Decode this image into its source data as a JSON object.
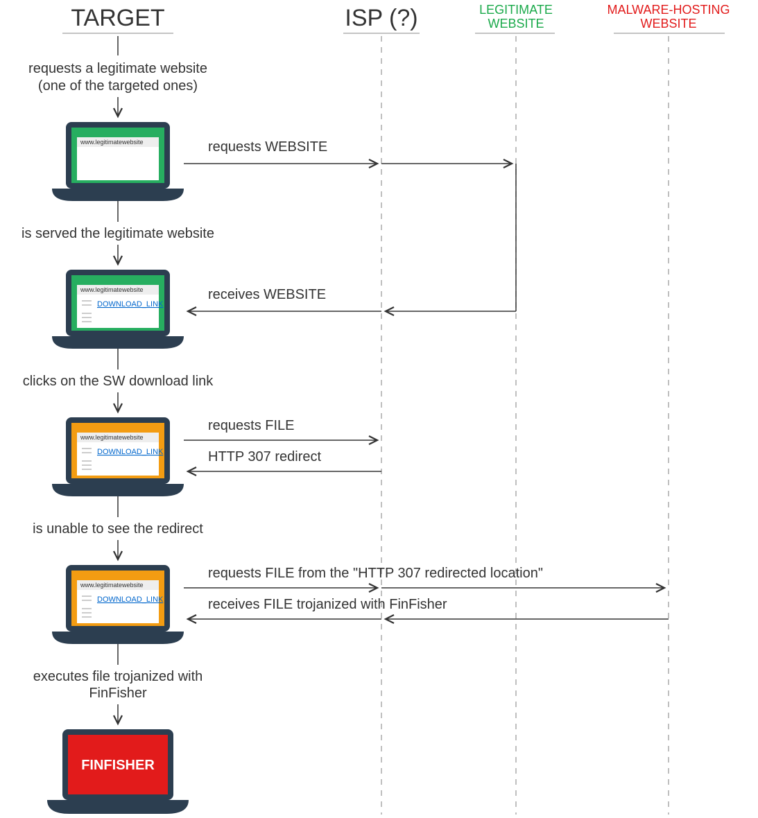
{
  "columns": {
    "target": "TARGET",
    "isp": "ISP (?)",
    "legit": "LEGITIMATE",
    "legit2": "WEBSITE",
    "mal": "MALWARE-HOSTING",
    "mal2": "WEBSITE"
  },
  "steps": {
    "s1a": "requests a legitimate website",
    "s1b": "(one of the targeted ones)",
    "s2": "is served the legitimate website",
    "s3": "clicks on the SW download link",
    "s4": "is unable to see the redirect",
    "s5a": "executes file trojanized with",
    "s5b": "FinFisher"
  },
  "arrows": {
    "a1": "requests WEBSITE",
    "a2": "receives WEBSITE",
    "a3": "requests FILE",
    "a4": "HTTP 307 redirect",
    "a5": "requests FILE from the \"HTTP 307 redirected location\"",
    "a6": "receives FILE trojanized with FinFisher"
  },
  "laptop": {
    "url": "www.legitimatewebsite",
    "link": "DOWNLOAD_LINK",
    "final": "FINFISHER"
  }
}
